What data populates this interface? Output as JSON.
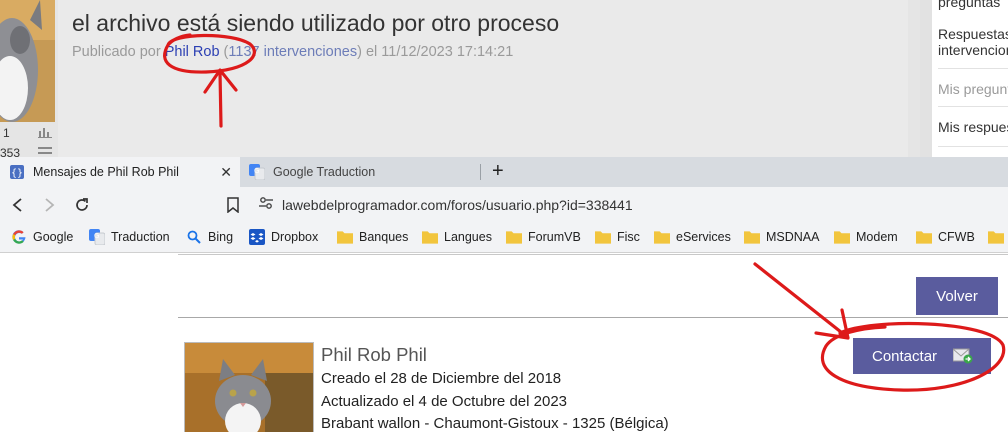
{
  "forum": {
    "post_title": "el archivo está siendo utilizado por otro proceso",
    "meta_prefix": "Publicado por",
    "author": "Phil Rob",
    "count_open": "(",
    "count": "1137 intervenciones",
    "count_close": ")",
    "meta_date": "el 11/12/2023 17:14:21",
    "user_stat_1": "1",
    "user_stat_2": "353",
    "sidebar": {
      "item_top": "preguntas",
      "item_respuestas_1": "Respuestas",
      "item_respuestas_2": "intervenciones",
      "item_mis_preguntas": "Mis preguntas",
      "item_mis_respuestas": "Mis respuestas"
    }
  },
  "browser": {
    "tabs": [
      {
        "label": "Mensajes de Phil Rob Phil",
        "icon": "page-braces-icon",
        "close": "✕"
      },
      {
        "label": "Google Traduction",
        "icon": "google-translate-icon"
      }
    ],
    "new_tab": "+",
    "url": "lawebdelprogramador.com/foros/usuario.php?id=338441",
    "bookmarks": [
      {
        "label": "Google",
        "icon": "google-icon"
      },
      {
        "label": "Traduction",
        "icon": "google-translate-icon"
      },
      {
        "label": "Bing",
        "icon": "search-icon"
      },
      {
        "label": "Dropbox",
        "icon": "dropbox-icon"
      },
      {
        "label": "Banques",
        "icon": "folder-icon"
      },
      {
        "label": "Langues",
        "icon": "folder-icon"
      },
      {
        "label": "ForumVB",
        "icon": "folder-icon"
      },
      {
        "label": "Fisc",
        "icon": "folder-icon"
      },
      {
        "label": "eServices",
        "icon": "folder-icon"
      },
      {
        "label": "MSDNAA",
        "icon": "folder-icon"
      },
      {
        "label": "Modem",
        "icon": "folder-icon"
      },
      {
        "label": "CFWB",
        "icon": "folder-icon"
      }
    ]
  },
  "profile": {
    "back_button": "Volver",
    "name": "Phil Rob Phil",
    "created": "Creado el 28 de Diciembre del 2018",
    "updated": "Actualizado el 4 de Octubre del 2023",
    "location": "Brabant wallon - Chaumont-Gistoux - 1325 (Bélgica)",
    "contact_button": "Contactar"
  },
  "colors": {
    "button_bg": "#5a5c9e",
    "annotation_red": "#dd1a1a",
    "link_blue": "#2b3fb3"
  }
}
